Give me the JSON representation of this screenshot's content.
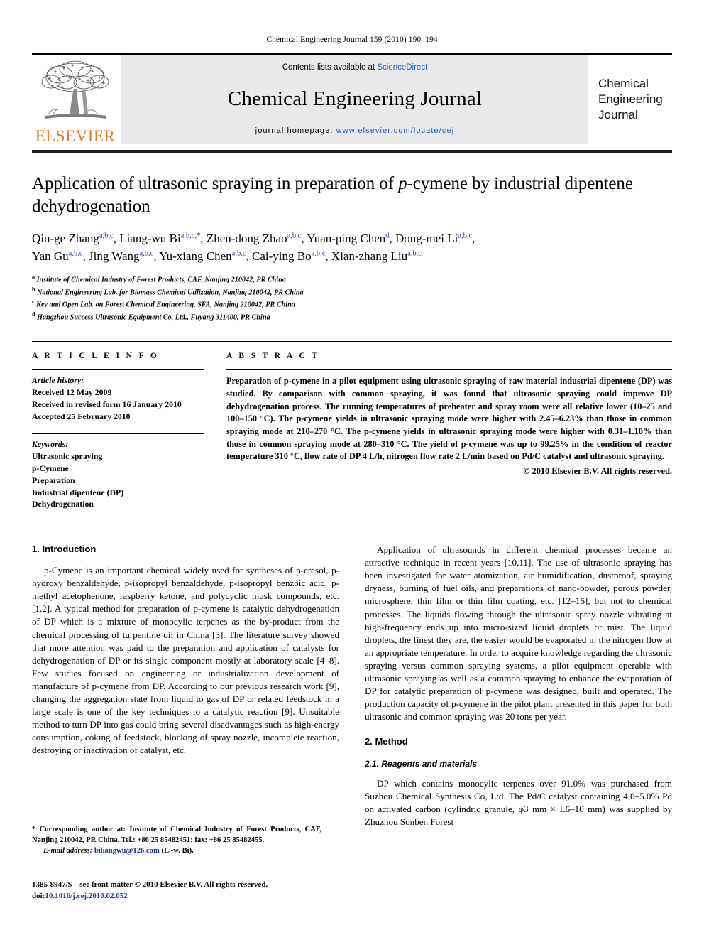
{
  "running_head": "Chemical Engineering Journal 159 (2010) 190–194",
  "masthead": {
    "contents_prefix": "Contents lists available at ",
    "sciencedirect": "ScienceDirect",
    "journal_name": "Chemical Engineering Journal",
    "homepage_prefix": "journal homepage:",
    "homepage_url": "www.elsevier.com/locate/cej",
    "publisher_wordmark": "ELSEVIER",
    "publisher_logo_icon": "elsevier-tree-icon",
    "cover_lines": [
      "Chemical",
      "Engineering",
      "Journal"
    ],
    "link_color": "#1a5fb4",
    "elsevier_orange": "#E87722"
  },
  "article": {
    "title": "Application of ultrasonic spraying in preparation of p-cymene by industrial dipentene dehydrogenation",
    "authors": [
      {
        "name": "Qiu-ge Zhang",
        "sup": "a,b,c",
        "corresponding": false
      },
      {
        "name": "Liang-wu Bi",
        "sup": "a,b,c,",
        "corresponding": true
      },
      {
        "name": "Zhen-dong Zhao",
        "sup": "a,b,c",
        "corresponding": false
      },
      {
        "name": "Yuan-ping Chen",
        "sup": "d",
        "corresponding": false
      },
      {
        "name": "Dong-mei Li",
        "sup": "a,b,c",
        "corresponding": false
      },
      {
        "name": "Yan Gu",
        "sup": "a,b,c",
        "corresponding": false
      },
      {
        "name": "Jing Wang",
        "sup": "a,b,c",
        "corresponding": false
      },
      {
        "name": "Yu-xiang Chen",
        "sup": "a,b,c",
        "corresponding": false
      },
      {
        "name": "Cai-ying Bo",
        "sup": "a,b,c",
        "corresponding": false
      },
      {
        "name": "Xian-zhang Liu",
        "sup": "a,b,c",
        "corresponding": false
      }
    ],
    "affiliations": [
      {
        "marker": "a",
        "text": "Institute of Chemical Industry of Forest Products, CAF, Nanjing 210042, PR China"
      },
      {
        "marker": "b",
        "text": "National Engineering Lab. for Biomass Chemical Utilization, Nanjing 210042, PR China"
      },
      {
        "marker": "c",
        "text": "Key and Open Lab. on Forest Chemical Engineering, SFA, Nanjing 210042, PR China"
      },
      {
        "marker": "d",
        "text": "Hangzhou Success Ultrasonic Equipment Co, Ltd., Fuyang 311400, PR China"
      }
    ]
  },
  "article_info": {
    "heading": "A R T I C L E    I N F O",
    "history_title": "Article history:",
    "history": [
      "Received 12 May 2009",
      "Received in revised form 16 January 2010",
      "Accepted 25 February 2010"
    ],
    "keywords_title": "Keywords:",
    "keywords": [
      "Ultrasonic spraying",
      "p-Cymene",
      "Preparation",
      "Industrial dipentene (DP)",
      "Dehydrogenation"
    ]
  },
  "abstract": {
    "heading": "A B S T R A C T",
    "text": "Preparation of p-cymene in a pilot equipment using ultrasonic spraying of raw material industrial dipentene (DP) was studied. By comparison with common spraying, it was found that ultrasonic spraying could improve DP dehydrogenation process. The running temperatures of preheater and spray room were all relative lower (10–25 and 100–150 °C). The p-cymene yields in ultrasonic spraying mode were higher with 2.45–6.23% than those in common spraying mode at 210–270 °C. The p-cymene yields in ultrasonic spraying mode were higher with 0.31–1.10% than those in common spraying mode at 280–310 °C. The yield of p-cymene was up to 99.25% in the condition of reactor temperature 310 °C, flow rate of DP 4 L/h, nitrogen flow rate 2 L/min based on Pd/C catalyst and ultrasonic spraying.",
    "copyright": "© 2010 Elsevier B.V. All rights reserved."
  },
  "sections": {
    "intro_heading": "1. Introduction",
    "intro_p1": "p-Cymene is an important chemical widely used for syntheses of p-cresol, p-hydroxy benzaldehyde, p-isopropyl benzaldehyde, p-isopropyl benzoic acid, p-methyl acetophenone, raspberry ketone, and polycyclic musk compounds, etc. [1,2]. A typical method for preparation of p-cymene is catalytic dehydrogenation of DP which is a mixture of monocylic terpenes as the by-product from the chemical processing of turpentine oil in China [3]. The literature survey showed that more attention was paid to the preparation and application of catalysts for dehydrogenation of DP or its single component mostly at laboratory scale [4–8]. Few studies focused on engineering or industrialization development of manufacture of p-cymene from DP. According to our previous research work [9], changing the aggregation state from liquid to gas of DP or related feedstock in a large scale is one of the key techniques to a catalytic reaction [9]. Unsuitable method to turn DP into gas could bring several disadvantages such as high-energy consumption, coking of feedstock, blocking of spray nozzle, incomplete reaction, destroying or inactivation of catalyst, etc.",
    "right_p1": "Application of ultrasounds in different chemical processes became an attractive technique in recent years [10,11]. The use of ultrasonic spraying has been investigated for water atomization, air humidification, dustproof, spraying dryness, burning of fuel oils, and preparations of nano-powder, porous powder, microsphere, thin film or thin film coating, etc. [12–16], but not to chemical processes. The liquids flowing through the ultrasonic spray nozzle vibrating at high-frequency ends up into micro-sized liquid droplets or mist. The liquid droplets, the finest they are, the easier would be evaporated in the nitrogen flow at an appropriate temperature. In order to acquire knowledge regarding the ultrasonic spraying versus common spraying systems, a pilot equipment operable with ultrasonic spraying as well as a common spraying to enhance the evaporation of DP for catalytic preparation of p-cymene was designed, built and operated. The production capacity of p-cymene in the pilot plant presented in this paper for both ultrasonic and common spraying was 20 tons per year.",
    "method_heading": "2. Method",
    "reagents_heading": "2.1. Reagents and materials",
    "reagents_p1": "DP which contains monocylic terpenes over 91.0% was purchased from Suzhou Chemical Synthesis Co, Ltd. The Pd/C catalyst containing 4.0–5.0% Pd on activated carbon (cylindric granule, φ3 mm × L6–10 mm) was supplied by Zhuzhou Sonben Forest"
  },
  "footnote": {
    "star": "*",
    "corresponding_text": "Corresponding author at: Institute of Chemical Industry of Forest Products, CAF, Nanjing 210042, PR China. Tel.: +86 25 85482451; fax: +86 25 85482455.",
    "email_label": "E-mail address:",
    "email": "biliangwu@126.com",
    "email_owner": "(L.-w. Bi)."
  },
  "imprint": {
    "line1": "1385-8947/$ – see front matter © 2010 Elsevier B.V. All rights reserved.",
    "doi_label": "doi:",
    "doi": "10.1016/j.cej.2010.02.052"
  }
}
